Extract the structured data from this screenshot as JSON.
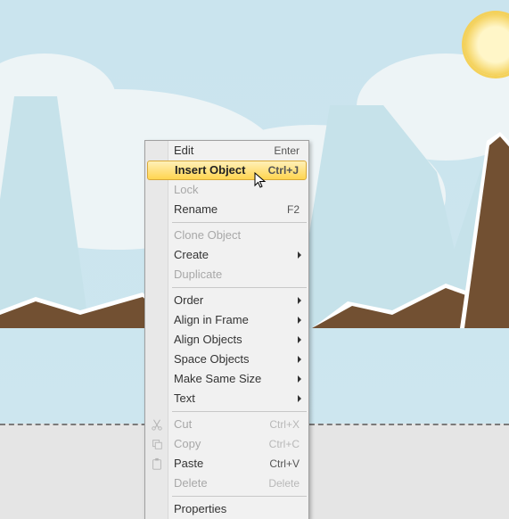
{
  "menu": {
    "items": [
      {
        "label": "Edit",
        "shortcut": "Enter",
        "disabled": false,
        "submenu": false,
        "highlight": false,
        "icon": null
      },
      {
        "label": "Insert Object",
        "shortcut": "Ctrl+J",
        "disabled": false,
        "submenu": false,
        "highlight": true,
        "icon": null
      },
      {
        "label": "Lock",
        "shortcut": "",
        "disabled": true,
        "submenu": false,
        "highlight": false,
        "icon": null
      },
      {
        "label": "Rename",
        "shortcut": "F2",
        "disabled": false,
        "submenu": false,
        "highlight": false,
        "icon": null
      },
      {
        "separator": true
      },
      {
        "label": "Clone Object",
        "shortcut": "",
        "disabled": true,
        "submenu": false,
        "highlight": false,
        "icon": null
      },
      {
        "label": "Create",
        "shortcut": "",
        "disabled": false,
        "submenu": true,
        "highlight": false,
        "icon": null
      },
      {
        "label": "Duplicate",
        "shortcut": "",
        "disabled": true,
        "submenu": false,
        "highlight": false,
        "icon": null
      },
      {
        "separator": true
      },
      {
        "label": "Order",
        "shortcut": "",
        "disabled": false,
        "submenu": true,
        "highlight": false,
        "icon": null
      },
      {
        "label": "Align in Frame",
        "shortcut": "",
        "disabled": false,
        "submenu": true,
        "highlight": false,
        "icon": null
      },
      {
        "label": "Align Objects",
        "shortcut": "",
        "disabled": false,
        "submenu": true,
        "highlight": false,
        "icon": null
      },
      {
        "label": "Space Objects",
        "shortcut": "",
        "disabled": false,
        "submenu": true,
        "highlight": false,
        "icon": null
      },
      {
        "label": "Make Same Size",
        "shortcut": "",
        "disabled": false,
        "submenu": true,
        "highlight": false,
        "icon": null
      },
      {
        "label": "Text",
        "shortcut": "",
        "disabled": false,
        "submenu": true,
        "highlight": false,
        "icon": null
      },
      {
        "separator": true
      },
      {
        "label": "Cut",
        "shortcut": "Ctrl+X",
        "disabled": true,
        "submenu": false,
        "highlight": false,
        "icon": "cut-icon"
      },
      {
        "label": "Copy",
        "shortcut": "Ctrl+C",
        "disabled": true,
        "submenu": false,
        "highlight": false,
        "icon": "copy-icon"
      },
      {
        "label": "Paste",
        "shortcut": "Ctrl+V",
        "disabled": false,
        "submenu": false,
        "highlight": false,
        "icon": "paste-icon"
      },
      {
        "label": "Delete",
        "shortcut": "Delete",
        "disabled": true,
        "submenu": false,
        "highlight": false,
        "icon": null
      },
      {
        "separator": true
      },
      {
        "label": "Properties",
        "shortcut": "",
        "disabled": false,
        "submenu": false,
        "highlight": false,
        "icon": null
      }
    ]
  },
  "colors": {
    "sky": "#cae4ee",
    "cloud": "#edf4f6",
    "mountain": "#c6e2ea",
    "terrain_dark": "#725032",
    "terrain_snow": "#ffffff",
    "highlight": "#ffd550",
    "menu_bg": "#f1f1f1"
  }
}
